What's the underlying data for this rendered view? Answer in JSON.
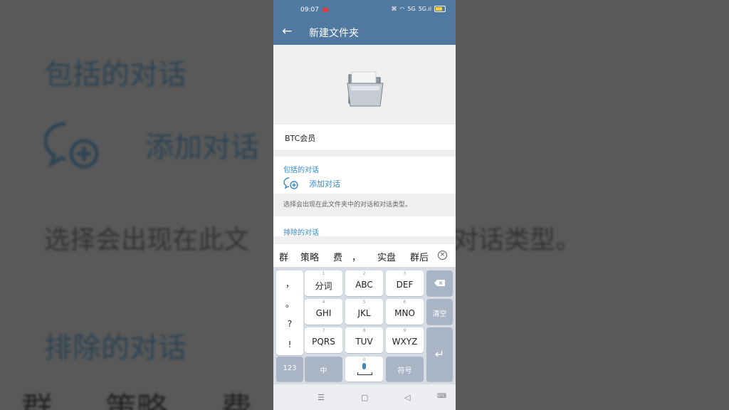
{
  "status": {
    "time": "09:07",
    "network": "5G",
    "signal": "5G.ıl"
  },
  "appbar": {
    "title": "新建文件夹"
  },
  "folder": {
    "name": "BTC会员"
  },
  "included": {
    "header": "包括的对话",
    "add_label": "添加对话",
    "hint": "选择会出现在此文件夹中的对话和对话类型。"
  },
  "excluded": {
    "header": "排除的对话"
  },
  "keyboard": {
    "candidates": [
      "群",
      "策略",
      "费",
      "，",
      "实盘",
      "群后"
    ],
    "punct": [
      "，",
      "。",
      "?",
      "!"
    ],
    "keys": [
      {
        "num": "1",
        "label": "分词"
      },
      {
        "num": "2",
        "label": "ABC"
      },
      {
        "num": "3",
        "label": "DEF"
      },
      {
        "num": "4",
        "label": "GHI"
      },
      {
        "num": "5",
        "label": "JKL"
      },
      {
        "num": "6",
        "label": "MNO"
      },
      {
        "num": "7",
        "label": "PQRS"
      },
      {
        "num": "8",
        "label": "TUV"
      },
      {
        "num": "9",
        "label": "WXYZ"
      }
    ],
    "clear_label": "清空",
    "num_label": "123",
    "lang_label": "中",
    "space_num": "0",
    "symbol_label": "符号"
  },
  "background": {
    "header1": "包括的对话",
    "add": "添加对话",
    "desc": "选择会出现在此文",
    "desc2": "加对话类型。",
    "header2": "排除的对话",
    "cand": "群 策略 费"
  },
  "colors": {
    "accent": "#5178a0",
    "link": "#3b87c4"
  }
}
